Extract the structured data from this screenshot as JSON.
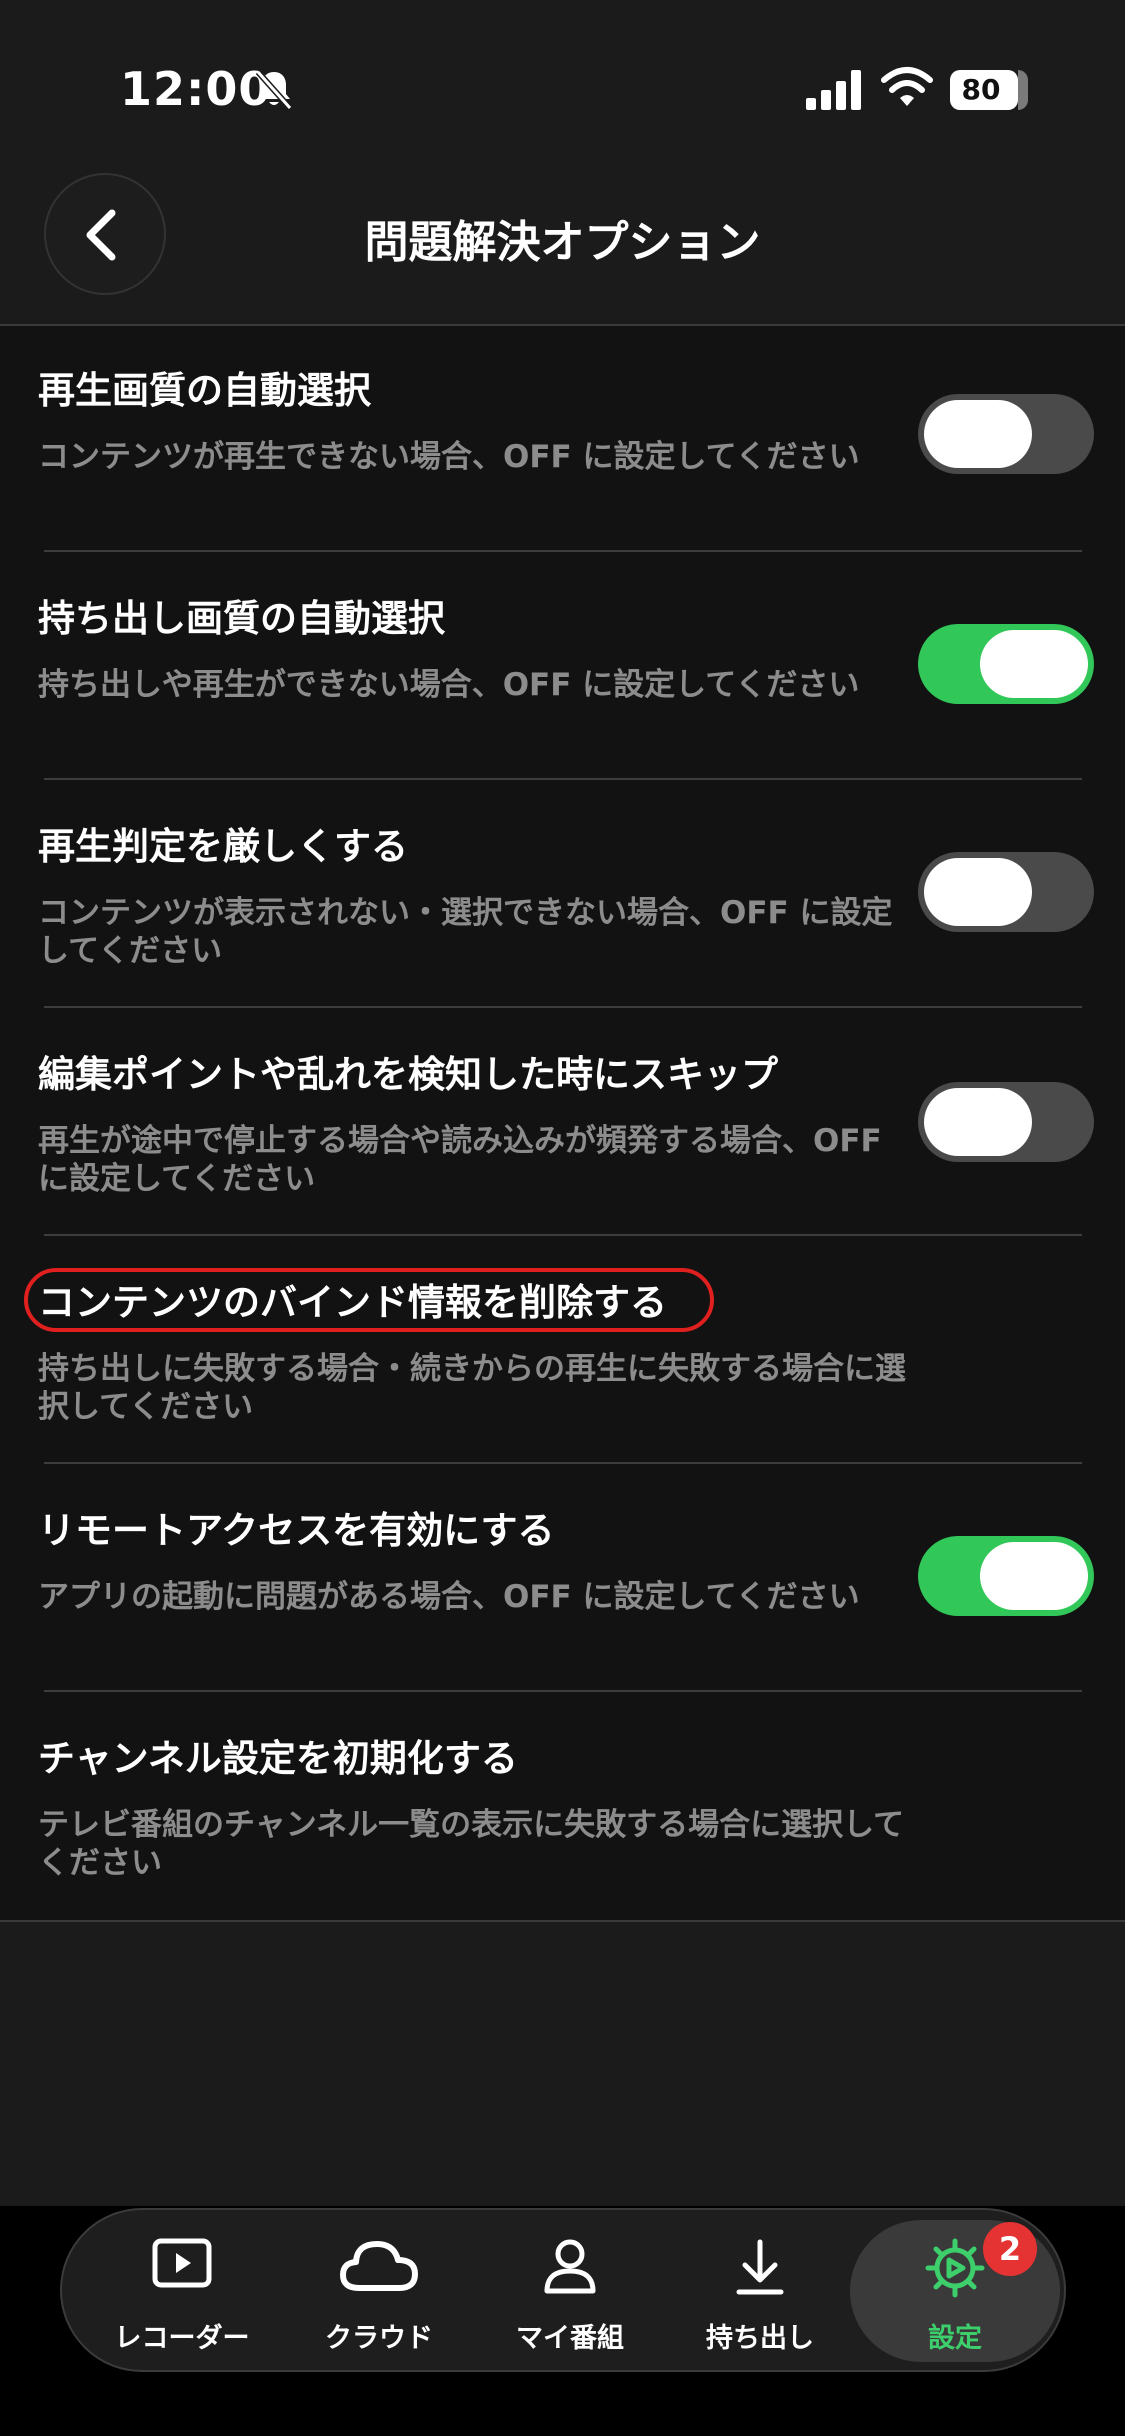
{
  "status_bar": {
    "time": "12:00",
    "battery": "80"
  },
  "header": {
    "title": "問題解決オプション"
  },
  "settings": [
    {
      "label": "再生画質の自動選択",
      "description": "コンテンツが再生できない場合、OFF に設定してください",
      "toggle": "off"
    },
    {
      "label": "持ち出し画質の自動選択",
      "description": "持ち出しや再生ができない場合、OFF に設定してください",
      "toggle": "on"
    },
    {
      "label": "再生判定を厳しくする",
      "description": "コンテンツが表示されない・選択できない場合、OFF に設定してください",
      "toggle": "off"
    },
    {
      "label": "編集ポイントや乱れを検知した時にスキップ",
      "description": "再生が途中で停止する場合や読み込みが頻発する場合、OFF に設定してください",
      "toggle": "off"
    },
    {
      "label": "コンテンツのバインド情報を削除する",
      "description": "持ち出しに失敗する場合・続きからの再生に失敗する場合に選択してください"
    },
    {
      "label": "リモートアクセスを有効にする",
      "description": "アプリの起動に問題がある場合、OFF に設定してください",
      "toggle": "on"
    },
    {
      "label": "チャンネル設定を初期化する",
      "description": "テレビ番組のチャンネル一覧の表示に失敗する場合に選択してください"
    }
  ],
  "tabs": [
    {
      "label": "レコーダー",
      "icon": "play-icon"
    },
    {
      "label": "クラウド",
      "icon": "cloud-icon"
    },
    {
      "label": "マイ番組",
      "icon": "person-icon"
    },
    {
      "label": "持ち出し",
      "icon": "download-icon"
    },
    {
      "label": "設定",
      "icon": "gear-icon",
      "active": true,
      "badge": "2"
    }
  ],
  "colors": {
    "accent_green": "#32c759",
    "highlight_red": "#e0201f",
    "badge_red": "#e53333"
  }
}
